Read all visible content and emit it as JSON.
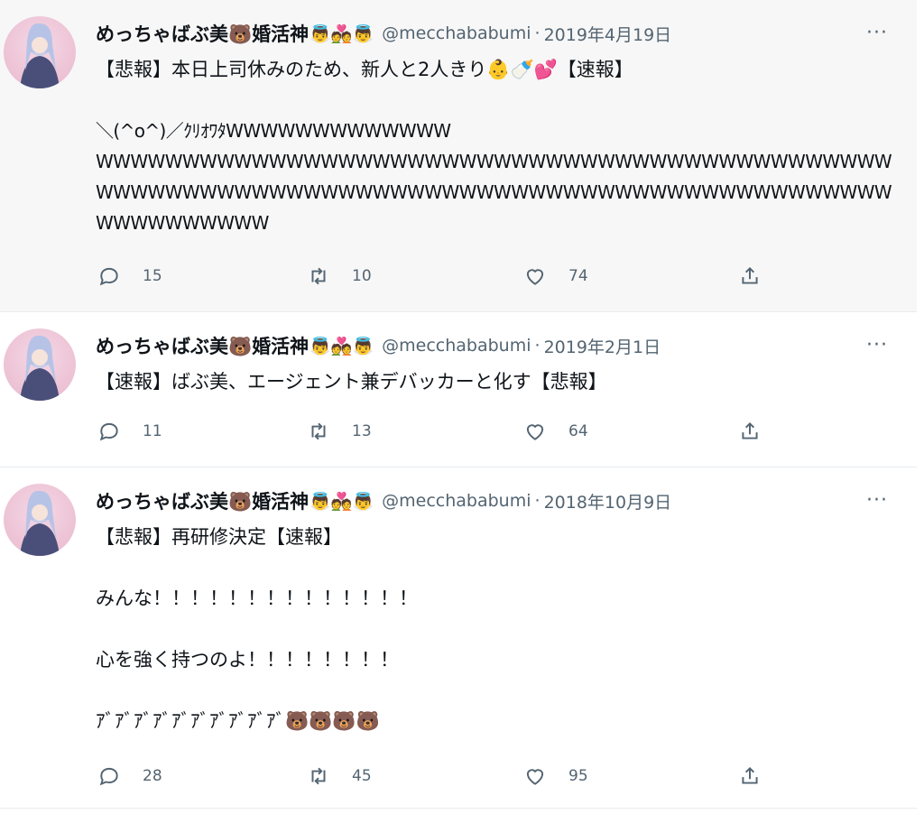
{
  "tweets": [
    {
      "name": "めっちゃばぶ美🐻婚活神",
      "emojis": "👼💑👼",
      "handle": "@mecchababumi",
      "dot": "·",
      "date": "2019年4月19日",
      "more": "···",
      "lines": [
        "【悲報】本日上司休みのため、新人と2人きり👶🍼💕【速報】",
        "",
        "＼(^o^)／ｸﾘｵﾜﾀWWWWWWWWWWWWW\nWWWWWWWWWWWWWWWWWWWWWWWWWWWWWWWWWWWWWWWWWWWWWWWWWWWWWWWWWWWWWWWWWWWWWWWWWWWWWWWWWWWWWWWWWWWWWWWWWWWWWW"
      ],
      "stats": {
        "replies": "15",
        "retweets": "10",
        "likes": "74"
      }
    },
    {
      "name": "めっちゃばぶ美🐻婚活神",
      "emojis": "👼💑👼",
      "handle": "@mecchababumi",
      "dot": "·",
      "date": "2019年2月1日",
      "more": "···",
      "lines": [
        "【速報】ばぶ美、エージェント兼デバッカーと化す【悲報】"
      ],
      "stats": {
        "replies": "11",
        "retweets": "13",
        "likes": "64"
      }
    },
    {
      "name": "めっちゃばぶ美🐻婚活神",
      "emojis": "👼💑👼",
      "handle": "@mecchababumi",
      "dot": "·",
      "date": "2018年10月9日",
      "more": "···",
      "lines": [
        "【悲報】再研修決定【速報】",
        "みんな！！！！！！！！！！！！！！",
        "心を強く持つのよ！！！！！！！！",
        "ｱﾞｱﾞｱﾞｱﾞｱﾞｱﾞｱﾞｱﾞｱﾞｱﾞ🐻🐻🐻🐻"
      ],
      "stats": {
        "replies": "28",
        "retweets": "45",
        "likes": "95"
      }
    }
  ]
}
